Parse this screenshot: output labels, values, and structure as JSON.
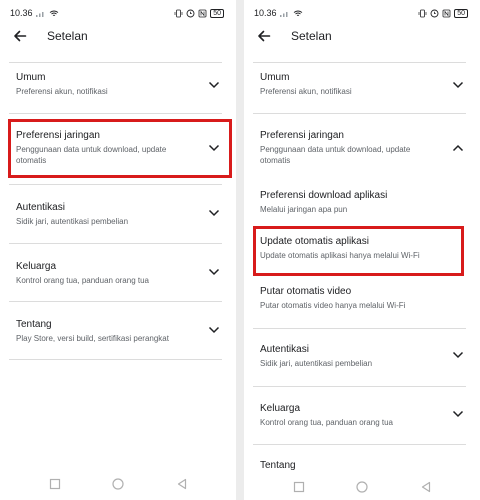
{
  "left": {
    "status": {
      "time": "10.36",
      "battery": "50"
    },
    "header": {
      "title": "Setelan"
    },
    "items": [
      {
        "title": "Umum",
        "subtitle": "Preferensi akun, notifikasi"
      },
      {
        "title": "Preferensi jaringan",
        "subtitle_line1": "Penggunaan data untuk download, update",
        "subtitle_line2": "otomatis"
      },
      {
        "title": "Autentikasi",
        "subtitle": "Sidik jari, autentikasi pembelian"
      },
      {
        "title": "Keluarga",
        "subtitle": "Kontrol orang tua, panduan orang tua"
      },
      {
        "title": "Tentang",
        "subtitle": "Play Store, versi build, sertifikasi perangkat"
      }
    ]
  },
  "right": {
    "status": {
      "time": "10.36",
      "battery": "50"
    },
    "header": {
      "title": "Setelan"
    },
    "items": [
      {
        "title": "Umum",
        "subtitle": "Preferensi akun, notifikasi"
      },
      {
        "title": "Preferensi jaringan",
        "subtitle_line1": "Penggunaan data untuk download, update",
        "subtitle_line2": "otomatis"
      },
      {
        "title": "Preferensi download aplikasi",
        "subtitle": "Melalui jaringan apa pun"
      },
      {
        "title": "Update otomatis aplikasi",
        "subtitle": "Update otomatis aplikasi hanya melalui Wi-Fi"
      },
      {
        "title": "Putar otomatis video",
        "subtitle": "Putar otomatis video hanya melalui Wi-Fi"
      },
      {
        "title": "Autentikasi",
        "subtitle": "Sidik jari, autentikasi pembelian"
      },
      {
        "title": "Keluarga",
        "subtitle": "Kontrol orang tua, panduan orang tua"
      },
      {
        "title": "Tentang"
      }
    ]
  },
  "colors": {
    "highlight": "#d81b1b",
    "text": "#202124",
    "secondary": "#5f6368",
    "divider": "#dcdcdc"
  },
  "icons": [
    "back-arrow-icon",
    "chevron-down-icon",
    "chevron-up-icon",
    "square-nav-icon",
    "circle-nav-icon",
    "triangle-back-nav-icon"
  ]
}
